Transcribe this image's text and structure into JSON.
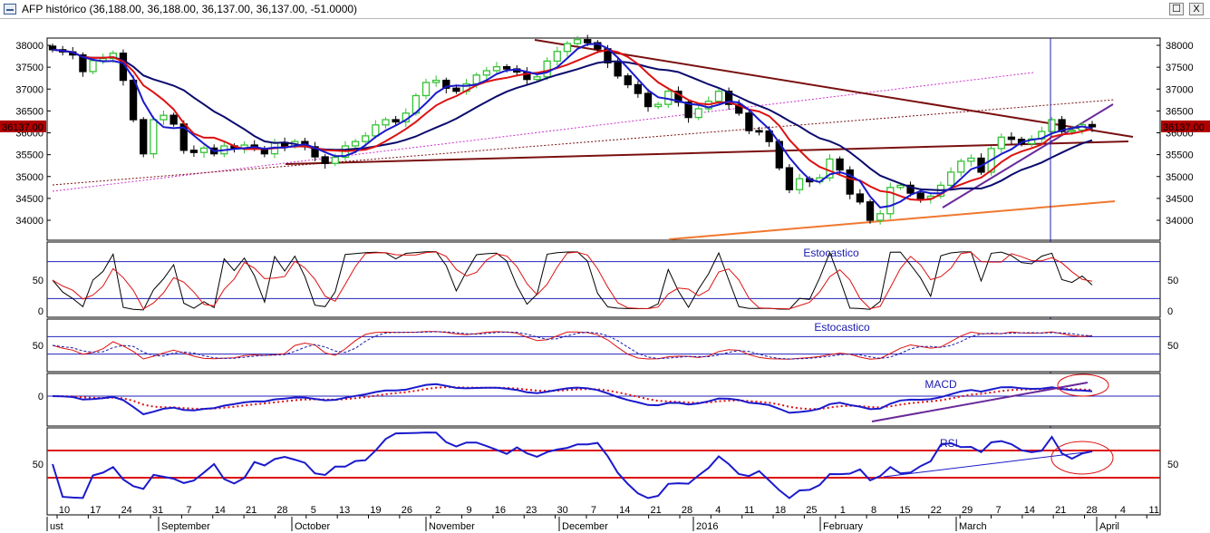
{
  "window": {
    "title": "AFP histórico (36,188.00, 36,188.00, 36,137.00, 36,137.00, -51.0000)",
    "maximize_glyph": "☐",
    "close_glyph": "X"
  },
  "colors": {
    "bull": "#33c233",
    "bear": "#000000",
    "ma_fast": "#1a1acc",
    "ma_mid": "#dd1111",
    "ma_slow": "#0a0a6e",
    "trend_brown": "#7a1010",
    "trend_magenta": "#cc33cc",
    "trend_purple": "#6a2a9a",
    "trend_orange": "#f07830",
    "guide_blue": "#2222bb",
    "rsi_red": "#dd1111",
    "last_price_bg": "#b00000"
  },
  "chart_data": {
    "type": "candlestick",
    "instrument": "AFP",
    "last_price_label": "36137.00",
    "y_ticks": [
      "38000",
      "37500",
      "37000",
      "36500",
      "36000",
      "35500",
      "35000",
      "34500",
      "34000"
    ],
    "x_tick_labels": [
      "10",
      "17",
      "24",
      "31",
      "7",
      "14",
      "21",
      "28",
      "5",
      "13",
      "19",
      "26",
      "2",
      "9",
      "16",
      "23",
      "30",
      "7",
      "14",
      "21",
      "28",
      "4",
      "11",
      "18",
      "25",
      "1",
      "8",
      "15",
      "22",
      "29",
      "7",
      "14",
      "21",
      "28",
      "4",
      "11"
    ],
    "month_labels": [
      "ust",
      "September",
      "October",
      "November",
      "December",
      "2016",
      "February",
      "March",
      "April"
    ],
    "close": [
      37900,
      37850,
      37780,
      37400,
      37650,
      37700,
      37820,
      37200,
      36300,
      35520,
      36300,
      36400,
      36200,
      35600,
      35550,
      35650,
      35520,
      35700,
      35650,
      35720,
      35640,
      35520,
      35780,
      35700,
      35800,
      35680,
      35450,
      35300,
      35440,
      35700,
      35800,
      35930,
      36180,
      36300,
      36250,
      36450,
      36850,
      37150,
      37200,
      37020,
      36950,
      37120,
      37320,
      37420,
      37510,
      37460,
      37390,
      37220,
      37280,
      37640,
      37860,
      38040,
      38130,
      38060,
      37920,
      37600,
      37300,
      37100,
      36900,
      36600,
      36650,
      36950,
      36700,
      36350,
      36550,
      36720,
      36950,
      36650,
      36450,
      36050,
      36040,
      35800,
      35200,
      34700,
      34950,
      34880,
      34970,
      35400,
      35150,
      34600,
      34420,
      34000,
      34150,
      34750,
      34800,
      34620,
      34500,
      34550,
      34800,
      35100,
      35350,
      35420,
      35100,
      35640,
      35900,
      35850,
      35750,
      35860,
      36030,
      36300,
      36030,
      36060,
      36188,
      36137
    ],
    "panels": [
      {
        "title": "Estocastico",
        "y_ticks": [
          "50",
          "0"
        ],
        "guide_levels": [
          80,
          20
        ]
      },
      {
        "title": "Estocastico",
        "y_ticks": [
          "50"
        ],
        "guide_levels": [
          80,
          20
        ]
      },
      {
        "title": "MACD",
        "y_ticks": [
          "0"
        ],
        "guide_levels": [
          0
        ]
      },
      {
        "title": "RSI",
        "y_ticks": [
          "50"
        ],
        "guide_levels": [
          70,
          30
        ]
      }
    ],
    "indicators": [
      "SMA fast",
      "SMA mid",
      "SMA slow",
      "Stochastic fast",
      "Stochastic slow",
      "MACD",
      "RSI"
    ]
  }
}
